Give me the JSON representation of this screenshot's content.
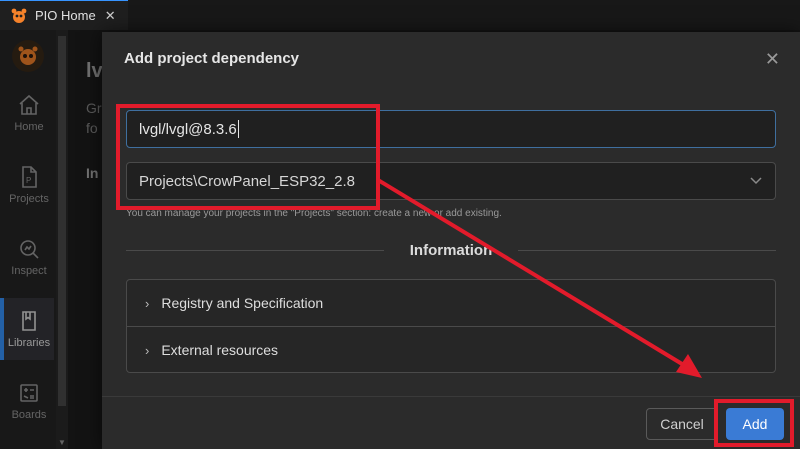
{
  "tab": {
    "title": "PIO Home",
    "close": "✕"
  },
  "sidebar": {
    "items": [
      {
        "label": "Home",
        "icon": "home-icon"
      },
      {
        "label": "Projects",
        "icon": "projects-icon"
      },
      {
        "label": "Inspect",
        "icon": "inspect-icon"
      },
      {
        "label": "Libraries",
        "icon": "libraries-icon",
        "active": true
      },
      {
        "label": "Boards",
        "icon": "boards-icon"
      }
    ]
  },
  "background_page": {
    "title_fragment": "lv",
    "frag1": "Gr",
    "frag2": "fo",
    "frag3": "In"
  },
  "modal": {
    "title": "Add project dependency",
    "close": "✕",
    "package_input": {
      "value": "lvgl/lvgl@8.3.6"
    },
    "project_select": {
      "value": "Projects\\CrowPanel_ESP32_2.8",
      "chevron": "⌵"
    },
    "helper": "You can manage your projects in the \"Projects\" section: create a new or add existing.",
    "section_title": "Information",
    "accordion": [
      {
        "label": "Registry and Specification",
        "chevron": "›"
      },
      {
        "label": "External resources",
        "chevron": "›"
      }
    ],
    "buttons": {
      "cancel": "Cancel",
      "add": "Add"
    }
  },
  "colors": {
    "accent": "#3a7bd5",
    "annotation": "#e21b2b",
    "modal_bg": "#2b2b2b"
  }
}
